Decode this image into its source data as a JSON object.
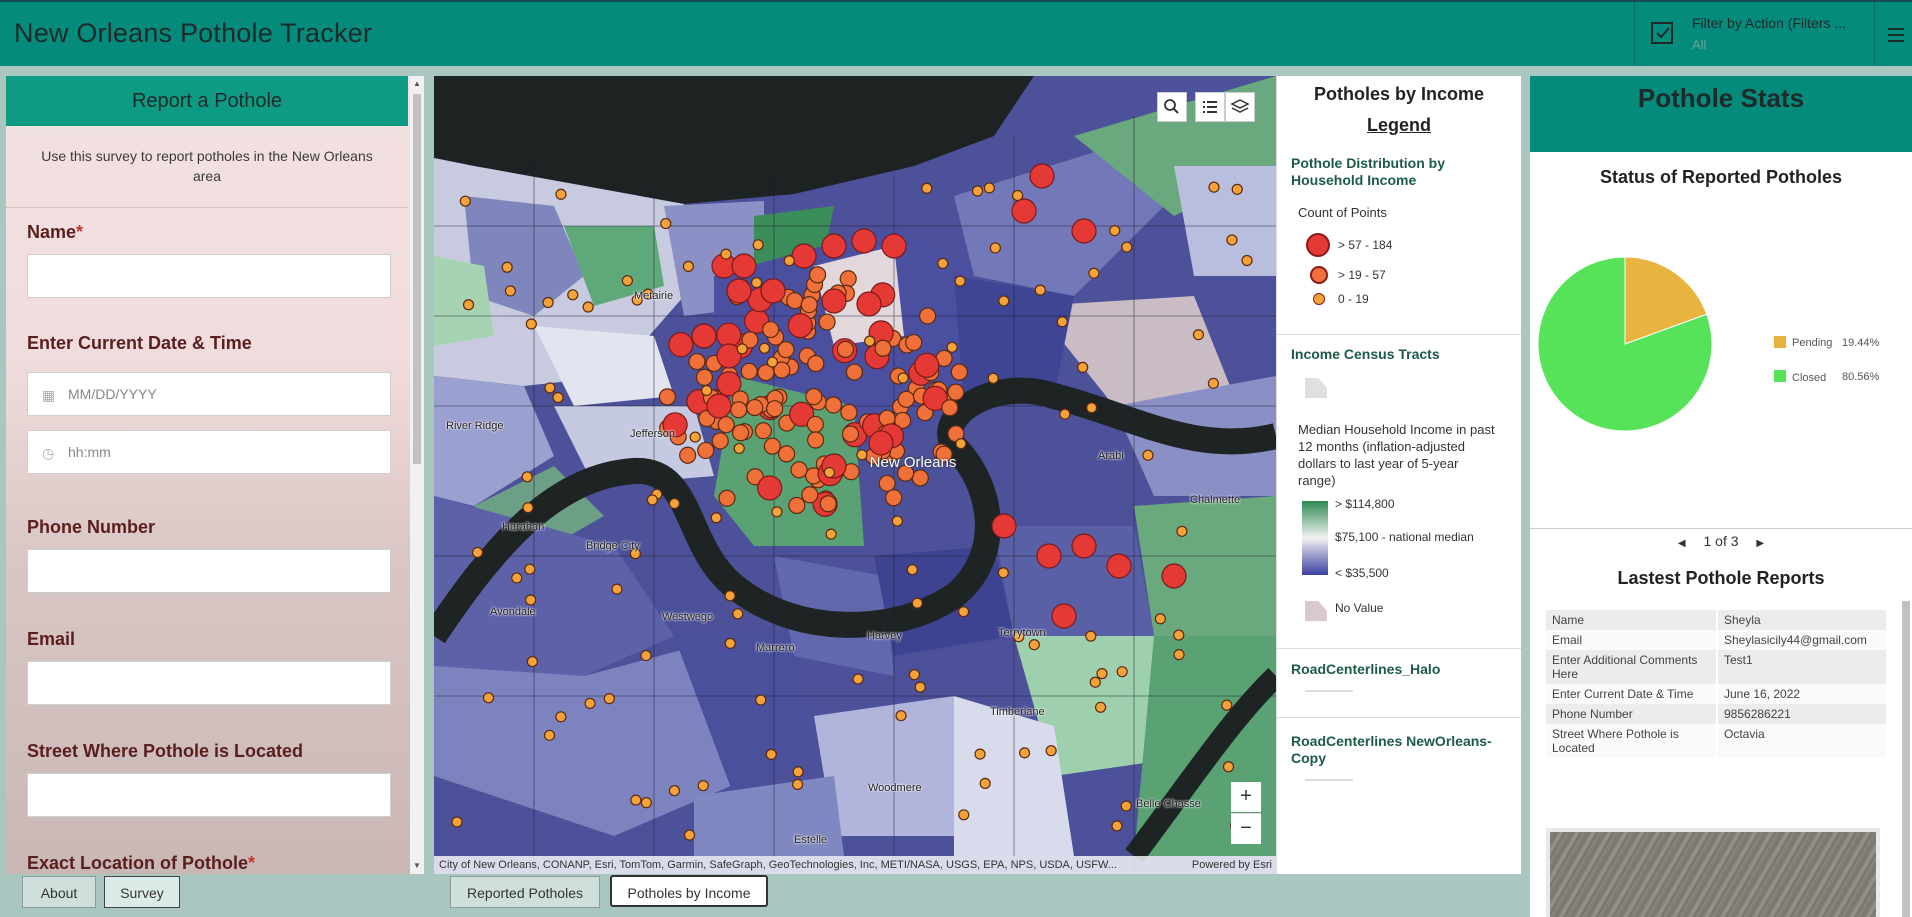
{
  "app": {
    "title": "New Orleans Pothole Tracker",
    "filter_title": "Filter by Action (Filters ...",
    "filter_value": "All",
    "icons": [
      "checkbox-icon",
      "menu-icon"
    ]
  },
  "survey": {
    "header": "Report a Pothole",
    "description": "Use this survey to report potholes in the New Orleans area",
    "fields": {
      "name_label": "Name",
      "date_label": "Enter Current Date & Time",
      "date_placeholder": "MM/DD/YYYY",
      "time_placeholder": "hh:mm",
      "phone_label": "Phone Number",
      "email_label": "Email",
      "street_label": "Street Where Pothole is Located",
      "location_label": "Exact Location of Pothole"
    },
    "required_mark": "*"
  },
  "map": {
    "attribution": "City of New Orleans, CONANP, Esri, TomTom, Garmin, SafeGraph, GeoTechnologies, Inc, METI/NASA, USGS, EPA, NPS, USDA, USFW...",
    "powered_by": "Powered by Esri",
    "zoom_in": "+",
    "zoom_out": "−",
    "places": {
      "metairie": "Metairie",
      "jefferson": "Jefferson",
      "river_ridge": "River Ridge",
      "harahan": "Harahan",
      "bridge_city": "Bridge City",
      "avondale": "Avondale",
      "westwego": "Westwego",
      "marrero": "Marrero",
      "harvey": "Harvey",
      "terrytown": "Terrytown",
      "timberlane": "Timberlane",
      "woodmere": "Woodmere",
      "estelle": "Estelle",
      "chalmette": "Chalmette",
      "arabi": "Arabi",
      "belle_chasse": "Belle Chasse",
      "new_orleans": "New Orleans"
    }
  },
  "legend": {
    "title": "Potholes by Income",
    "subtitle": "Legend",
    "layer1_title": "Pothole Distribution by Household Income",
    "count_label": "Count of Points",
    "classes": [
      "> 57 - 184",
      "> 19 - 57",
      "0 - 19"
    ],
    "layer2_title": "Income Census Tracts",
    "income_desc": "Median Household Income in past 12 months (inflation-adjusted dollars to last year of 5-year range)",
    "ramp_labels": [
      "> $114,800",
      "$75,100 - national median",
      "< $35,500"
    ],
    "no_value": "No Value",
    "layer3_title": "RoadCenterlines_Halo",
    "layer4_title": "RoadCenterlines NewOrleans-Copy"
  },
  "stats": {
    "title": "Pothole Stats",
    "chart_title": "Status of Reported Potholes",
    "pager": "1 of 3",
    "reports_title": "Lastest Pothole Reports",
    "report_rows": [
      [
        "Name",
        "Sheyla"
      ],
      [
        "Email",
        "Sheylasicily44@gmail.com"
      ],
      [
        "Enter Additional Comments Here",
        "Test1"
      ],
      [
        "Enter Current Date & Time",
        "June 16, 2022"
      ],
      [
        "Phone Number",
        "9856286221"
      ],
      [
        "Street Where Pothole is Located",
        "Octavia"
      ]
    ]
  },
  "chart_data": {
    "type": "pie",
    "title": "Status of Reported Potholes",
    "categories": [
      "Pending",
      "Closed"
    ],
    "values": [
      19.44,
      80.56
    ],
    "value_labels": [
      "19.44%",
      "80.56%"
    ],
    "colors": [
      "#e8b33e",
      "#56e35a"
    ],
    "legend_position": "right"
  },
  "tabs": {
    "left": [
      "About",
      "Survey"
    ],
    "map": [
      "Reported Potholes",
      "Potholes by Income"
    ]
  }
}
